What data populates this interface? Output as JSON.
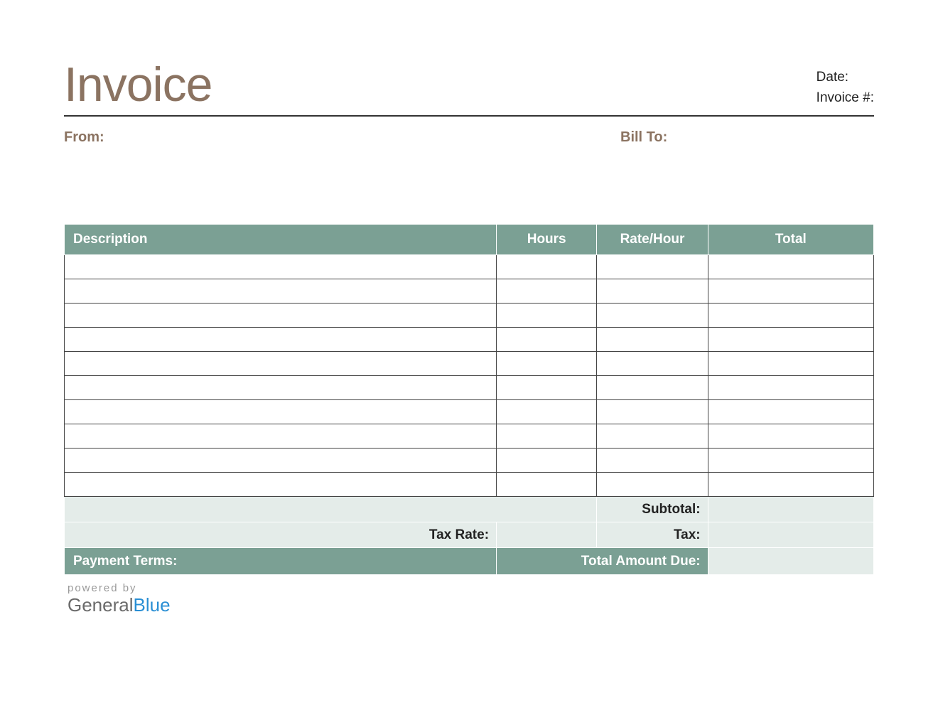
{
  "title": "Invoice",
  "meta": {
    "date_label": "Date:",
    "invoice_number_label": "Invoice #:"
  },
  "parties": {
    "from_label": "From:",
    "bill_to_label": "Bill To:"
  },
  "table": {
    "headers": {
      "description": "Description",
      "hours": "Hours",
      "rate": "Rate/Hour",
      "total": "Total"
    },
    "rows": [
      {
        "description": "",
        "hours": "",
        "rate": "",
        "total": ""
      },
      {
        "description": "",
        "hours": "",
        "rate": "",
        "total": ""
      },
      {
        "description": "",
        "hours": "",
        "rate": "",
        "total": ""
      },
      {
        "description": "",
        "hours": "",
        "rate": "",
        "total": ""
      },
      {
        "description": "",
        "hours": "",
        "rate": "",
        "total": ""
      },
      {
        "description": "",
        "hours": "",
        "rate": "",
        "total": ""
      },
      {
        "description": "",
        "hours": "",
        "rate": "",
        "total": ""
      },
      {
        "description": "",
        "hours": "",
        "rate": "",
        "total": ""
      },
      {
        "description": "",
        "hours": "",
        "rate": "",
        "total": ""
      },
      {
        "description": "",
        "hours": "",
        "rate": "",
        "total": ""
      }
    ],
    "summary": {
      "subtotal_label": "Subtotal:",
      "tax_rate_label": "Tax Rate:",
      "tax_label": "Tax:",
      "payment_terms_label": "Payment Terms:",
      "total_due_label": "Total Amount Due:"
    }
  },
  "footer": {
    "powered_by": "powered by",
    "brand_general": "General",
    "brand_blue": "Blue"
  }
}
